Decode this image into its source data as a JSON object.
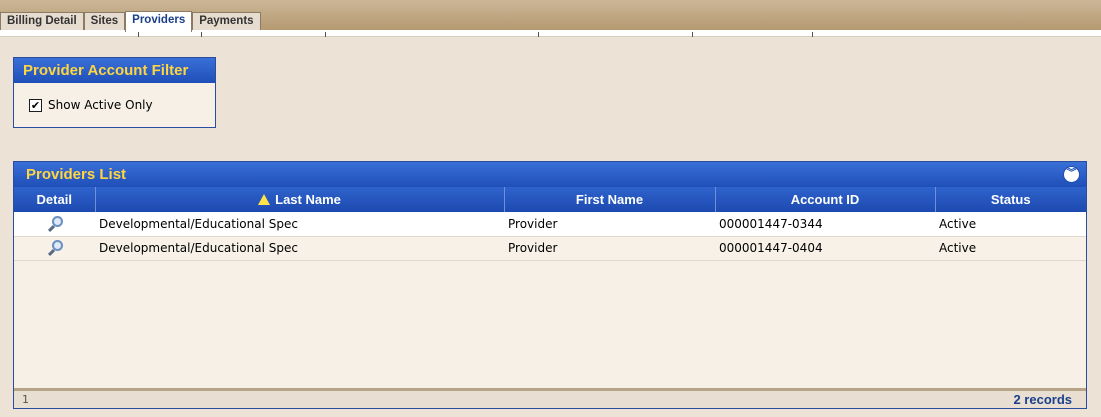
{
  "tabs": [
    {
      "label": "Billing Detail"
    },
    {
      "label": "Sites"
    },
    {
      "label": "Providers",
      "active": true
    },
    {
      "label": "Payments"
    }
  ],
  "filter_panel": {
    "title": "Provider Account Filter",
    "show_active_only": {
      "label": "Show Active Only",
      "checked": true
    }
  },
  "providers_list": {
    "title": "Providers List",
    "columns": {
      "detail": "Detail",
      "last_name": "Last Name",
      "first_name": "First Name",
      "account_id": "Account ID",
      "status": "Status"
    },
    "rows": [
      {
        "last_name": "Developmental/Educational Spec",
        "first_name": "Provider",
        "account_id": "000001447-0344",
        "status": "Active"
      },
      {
        "last_name": "Developmental/Educational Spec",
        "first_name": "Provider",
        "account_id": "000001447-0404",
        "status": "Active"
      }
    ],
    "footer": {
      "page": "1",
      "records": "2 records"
    }
  },
  "colors": {
    "panel_header": "#1f4fb8",
    "panel_title_text": "#ffd640",
    "background": "#ece3d6"
  },
  "icons": {
    "detail": "magnifier-icon",
    "sort": "sort-ascending-icon",
    "collapse": "collapse-chevron-icon"
  }
}
